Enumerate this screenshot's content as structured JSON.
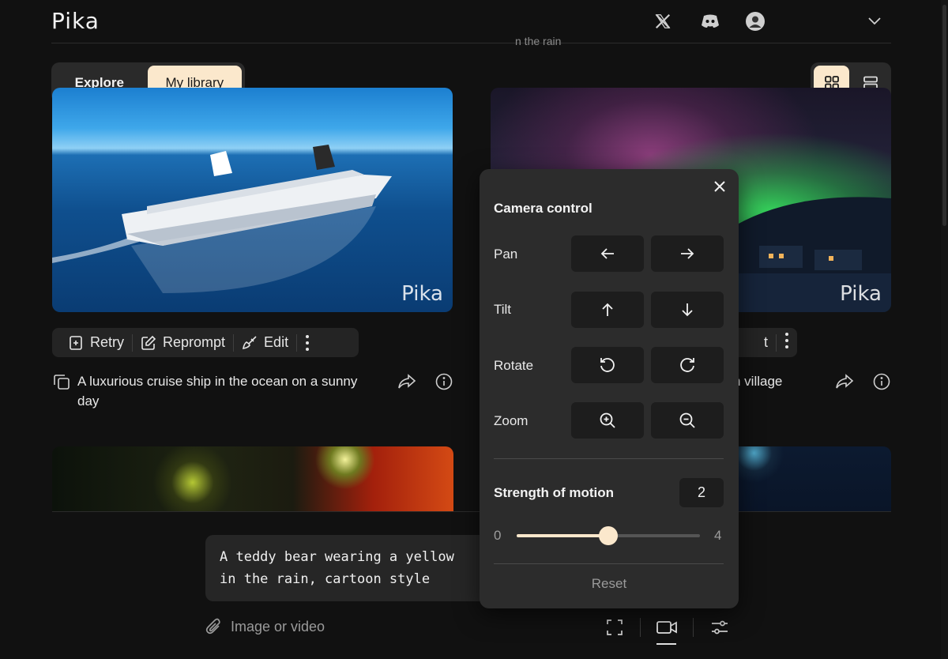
{
  "header": {
    "logo": "Pika",
    "peek_text": "n the rain"
  },
  "tabs": [
    {
      "label": "Explore"
    },
    {
      "label": "My library"
    }
  ],
  "cards": [
    {
      "watermark": "Pika",
      "caption": "A luxurious cruise ship in the ocean on a sunny day",
      "actions": [
        "Retry",
        "Reprompt",
        "Edit"
      ]
    },
    {
      "watermark": "Pika",
      "caption_partial": "n village",
      "action_partial": "t"
    }
  ],
  "camera_panel": {
    "title": "Camera control",
    "rows": [
      {
        "label": "Pan",
        "buttons": [
          "arrow-left-icon",
          "arrow-right-icon"
        ]
      },
      {
        "label": "Tilt",
        "buttons": [
          "arrow-up-icon",
          "arrow-down-icon"
        ]
      },
      {
        "label": "Rotate",
        "buttons": [
          "rotate-ccw-icon",
          "rotate-cw-icon"
        ]
      },
      {
        "label": "Zoom",
        "buttons": [
          "zoom-in-icon",
          "zoom-out-icon"
        ]
      }
    ],
    "strength": {
      "label": "Strength of motion",
      "value": "2",
      "min": "0",
      "max": "4",
      "fraction": 0.5
    },
    "reset_label": "Reset"
  },
  "prompt": {
    "text": "A teddy bear wearing a yellow\nin the rain, cartoon style",
    "attach_label": "Image or video"
  },
  "colors": {
    "accent": "#fbe8cc",
    "background": "#111111",
    "panel": "#2c2c2c"
  }
}
